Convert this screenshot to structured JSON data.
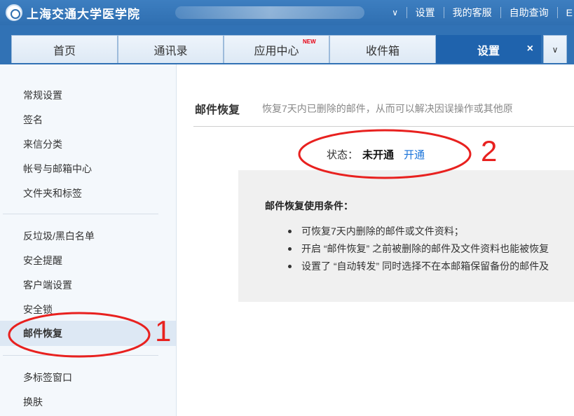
{
  "header": {
    "logo_text": "上海交通大学医学院",
    "links": [
      "设置",
      "我的客服",
      "自助查询",
      "E"
    ]
  },
  "tabs": [
    {
      "label": "首页"
    },
    {
      "label": "通讯录"
    },
    {
      "label": "应用中心",
      "badge": "NEW"
    },
    {
      "label": "收件箱"
    },
    {
      "label": "设置",
      "close": "×"
    }
  ],
  "sidebar": {
    "group1": [
      "常规设置",
      "签名",
      "来信分类",
      "帐号与邮箱中心",
      "文件夹和标签"
    ],
    "group2": [
      "反垃圾/黑白名单",
      "安全提醒",
      "客户端设置",
      "安全锁",
      "邮件恢复"
    ],
    "group3": [
      "多标签窗口",
      "换肤"
    ]
  },
  "main": {
    "title": "邮件恢复",
    "description": "恢复7天内已删除的邮件，从而可以解决因误操作或其他原",
    "status_label": "状态：",
    "status_value": "未开通",
    "enable_link": "开通",
    "conditions_title": "邮件恢复使用条件：",
    "conditions": [
      "可恢复7天内删除的邮件或文件资料；",
      "开启 “邮件恢复” 之前被删除的邮件及文件资料也能被恢复",
      "设置了 “自动转发” 同时选择不在本邮箱保留备份的邮件及"
    ]
  },
  "annotations": {
    "marker_1": "1",
    "marker_2": "2",
    "color": "#e8211f"
  }
}
